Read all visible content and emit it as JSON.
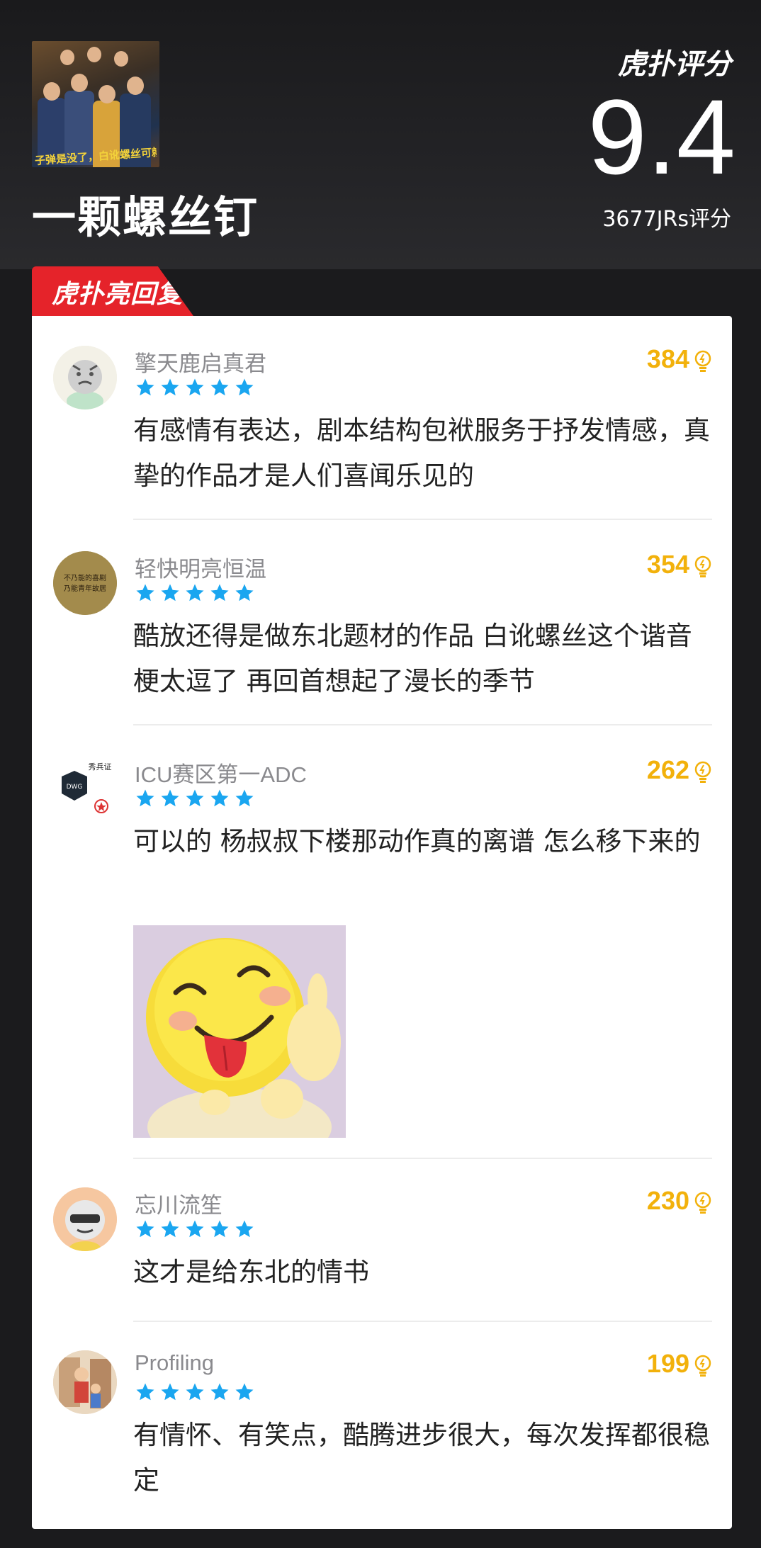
{
  "header": {
    "brand": "虎扑评分",
    "title": "一颗螺丝钉",
    "score": "9.4",
    "rating_count": "3677JRs评分",
    "poster_caption": "子弹是没了，白讹螺丝可就真转了"
  },
  "section": {
    "tag": "虎扑亮回复"
  },
  "colors": {
    "accent_red": "#e5232a",
    "likes_gold": "#f2b10b",
    "star_blue": "#1aa6f0"
  },
  "comments": [
    {
      "user": "擎天鹿启真君",
      "stars": 5,
      "likes": "384",
      "text": "有感情有表达，剧本结构包袱服务于抒发情感，真挚的作品才是人们喜闻乐见的",
      "has_sticker": false
    },
    {
      "user": "轻快明亮恒温",
      "stars": 5,
      "likes": "354",
      "avatar_text": "不乃能的喜剧 乃能青年故居",
      "text": "酷放还得是做东北题材的作品 白讹螺丝这个谐音梗太逗了 再回首想起了漫长的季节",
      "has_sticker": false
    },
    {
      "user": "ICU赛区第一ADC",
      "stars": 5,
      "likes": "262",
      "avatar_text": "秀兵证",
      "text": "可以的 杨叔叔下楼那动作真的离谱 怎么移下来的",
      "has_sticker": true
    },
    {
      "user": "忘川流笙",
      "stars": 5,
      "likes": "230",
      "text": "这才是给东北的情书",
      "has_sticker": false
    },
    {
      "user": "Profiling",
      "stars": 5,
      "likes": "199",
      "text": "有情怀、有笑点，酷腾进步很大，每次发挥都很稳定",
      "has_sticker": false
    }
  ]
}
